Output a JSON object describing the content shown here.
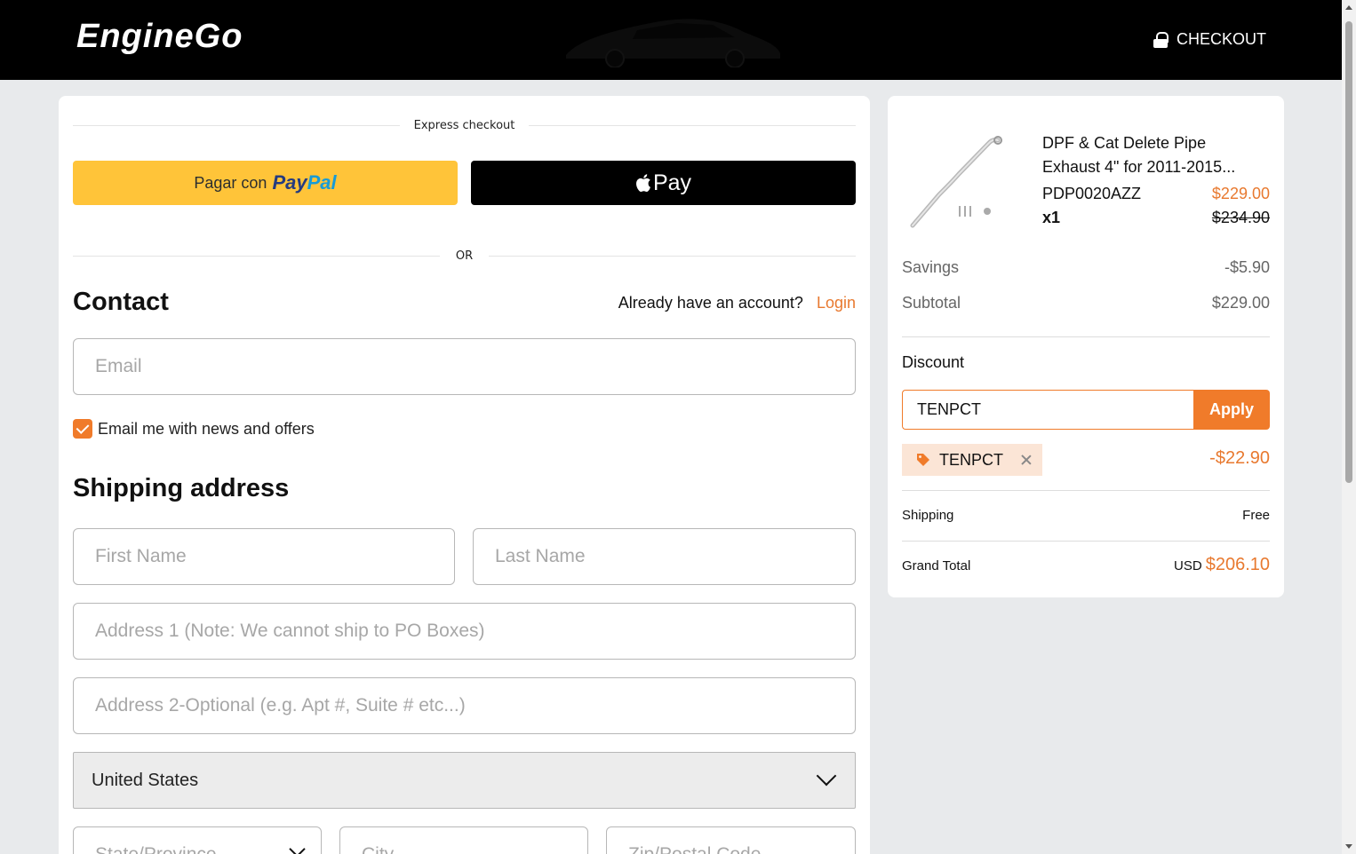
{
  "header": {
    "logo_text": "EngineGo",
    "checkout_label": "CHECKOUT"
  },
  "express": {
    "label": "Express checkout",
    "paypal_prefix": "Pagar con",
    "paypal_logo_a": "Pay",
    "paypal_logo_b": "Pal",
    "applepay_label": "Pay",
    "or_label": "OR"
  },
  "contact": {
    "title": "Contact",
    "account_prompt": "Already have an account?",
    "login_label": "Login",
    "email_placeholder": "Email",
    "newsletter_label": "Email me with news and offers",
    "newsletter_checked": true
  },
  "shipping": {
    "title": "Shipping address",
    "first_name_placeholder": "First Name",
    "last_name_placeholder": "Last Name",
    "address1_placeholder": "Address 1 (Note: We cannot ship to PO Boxes)",
    "address2_placeholder": "Address 2-Optional (e.g. Apt #, Suite # etc...)",
    "country_value": "United States",
    "state_placeholder": "State/Province",
    "city_placeholder": "City",
    "zip_placeholder": "Zip/Postal Code"
  },
  "summary": {
    "product_name": "DPF & Cat Delete Pipe Exhaust 4\" for 2011-2015...",
    "sku": "PDP0020AZZ",
    "quantity": "x1",
    "price_now": "$229.00",
    "price_was": "$234.90",
    "savings_label": "Savings",
    "savings_value": "-$5.90",
    "subtotal_label": "Subtotal",
    "subtotal_value": "$229.00",
    "discount_label": "Discount",
    "discount_code_value": "TENPCT",
    "apply_label": "Apply",
    "applied_code": "TENPCT",
    "discount_amount": "-$22.90",
    "shipping_label": "Shipping",
    "shipping_value": "Free",
    "grand_total_label": "Grand Total",
    "currency": "USD",
    "grand_total_value": "$206.10"
  },
  "colors": {
    "accent": "#f07b2a",
    "paypal_yellow": "#ffc439",
    "header_bg": "#000000"
  },
  "icons": [
    "lock-icon",
    "apple-icon",
    "checkbox-check-icon",
    "chevron-down-icon",
    "tag-icon",
    "close-icon"
  ]
}
